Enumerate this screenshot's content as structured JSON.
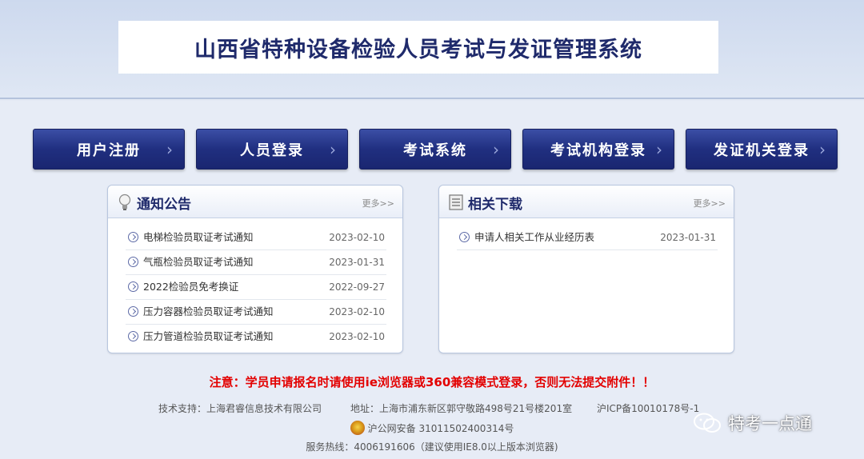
{
  "header": {
    "title": "山西省特种设备检验人员考试与发证管理系统"
  },
  "nav": [
    {
      "label": "用户注册"
    },
    {
      "label": "人员登录"
    },
    {
      "label": "考试系统"
    },
    {
      "label": "考试机构登录"
    },
    {
      "label": "发证机关登录"
    }
  ],
  "notice_panel": {
    "title": "通知公告",
    "more": "更多>>",
    "items": [
      {
        "text": "电梯检验员取证考试通知",
        "date": "2023-02-10"
      },
      {
        "text": "气瓶检验员取证考试通知",
        "date": "2023-01-31"
      },
      {
        "text": "2022检验员免考换证",
        "date": "2022-09-27"
      },
      {
        "text": "压力容器检验员取证考试通知",
        "date": "2023-02-10"
      },
      {
        "text": "压力管道检验员取证考试通知",
        "date": "2023-02-10"
      }
    ]
  },
  "download_panel": {
    "title": "相关下载",
    "more": "更多>>",
    "items": [
      {
        "text": "申请人相关工作从业经历表",
        "date": "2023-01-31"
      }
    ]
  },
  "warning": "注意：学员申请报名时请使用ie浏览器或360兼容模式登录，否则无法提交附件！！",
  "footer": {
    "support": "技术支持：上海君睿信息技术有限公司",
    "address": "地址：上海市浦东新区郭守敬路498号21号楼201室",
    "icp": "沪ICP备10010178号-1",
    "police": "沪公网安备 31011502400314号",
    "hotline": "服务热线：4006191606（建议使用IE8.0以上版本浏览器)"
  },
  "watermark": "特考一点通"
}
